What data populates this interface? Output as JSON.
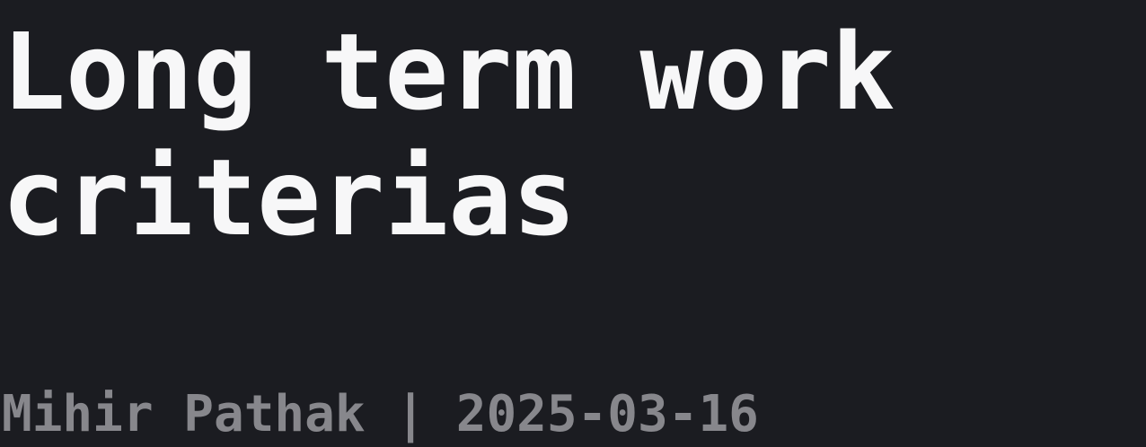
{
  "post": {
    "title_line1": "Long term work",
    "title_line2": "criterias",
    "byline": "Mihir Pathak | 2025-03-16"
  },
  "colors": {
    "background": "#1b1c21",
    "title": "#f7f7f8",
    "byline": "#87878c"
  }
}
